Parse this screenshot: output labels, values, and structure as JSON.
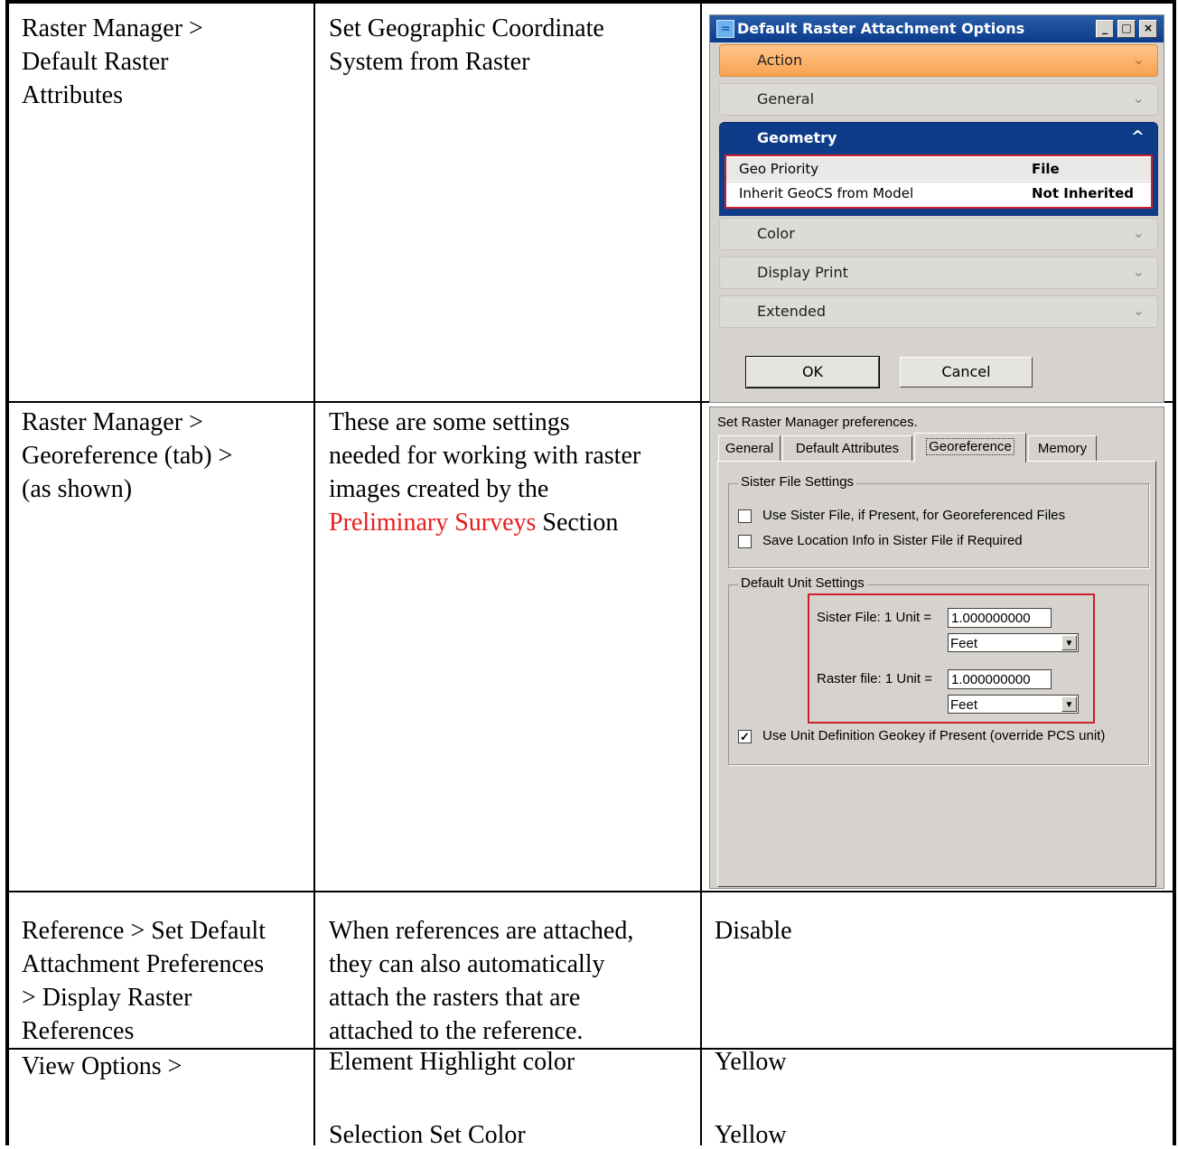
{
  "rows": [
    {
      "setting": "Raster Manager >\nDefault Raster\nAttributes",
      "description": "Set Geographic Coordinate\nSystem from Raster"
    },
    {
      "setting": "Raster Manager >\nGeoreference (tab) >\n(as shown)",
      "description_before": "These are some settings\nneeded for working with raster\nimages created by the\n",
      "description_link": "Preliminary Surveys",
      "description_after": " Section"
    },
    {
      "setting": "Reference > Set Default\nAttachment Preferences\n> Display Raster\nReferences",
      "description": "When references are attached,\nthey can also automatically\nattach the rasters that are\nattached to the reference.",
      "value": "Disable"
    },
    {
      "setting": "View Options >",
      "description": "Element Highlight color\n\n\nSelection Set Color",
      "value": "Yellow\n\n\nYellow"
    }
  ],
  "dialog1": {
    "title": "Default Raster Attachment Options",
    "panels": {
      "action": "Action",
      "general": "General",
      "geometry": "Geometry",
      "color": "Color",
      "display_print": "Display Print",
      "extended": "Extended"
    },
    "properties": [
      {
        "name": "Geo Priority",
        "value": "File"
      },
      {
        "name": "Inherit GeoCS from Model",
        "value": "Not Inherited"
      }
    ],
    "ok": "OK",
    "cancel": "Cancel"
  },
  "dialog2": {
    "caption": "Set Raster Manager preferences.",
    "tabs": [
      "General",
      "Default Attributes",
      "Georeference",
      "Memory"
    ],
    "active_tab": "Georeference",
    "sister_group_title": "Sister File Settings",
    "check_use_sister": {
      "label": "Use Sister File, if Present, for Georeferenced Files",
      "checked": false
    },
    "check_save_location": {
      "label": "Save Location Info in Sister File if Required",
      "checked": false
    },
    "unit_group_title": "Default Unit Settings",
    "sister_unit_label": "Sister File: 1 Unit =",
    "sister_unit_value": "1.000000000",
    "sister_unit_select": "Feet",
    "raster_unit_label": "Raster file: 1 Unit =",
    "raster_unit_value": "1.000000000",
    "raster_unit_select": "Feet",
    "check_geokey": {
      "label": "Use Unit Definition Geokey if Present (override PCS unit)",
      "checked": true
    }
  },
  "colors": {
    "link_red": "#e81c1c",
    "highlight_red": "#cc1f2a",
    "title_blue": "#0f3c88",
    "action_orange": "#f8a352"
  },
  "icons": [
    "app-icon",
    "minimize-icon",
    "maximize-icon",
    "close-icon",
    "chevron-down-icon",
    "chevron-up-icon",
    "checkbox-icon",
    "dropdown-arrow-icon"
  ]
}
